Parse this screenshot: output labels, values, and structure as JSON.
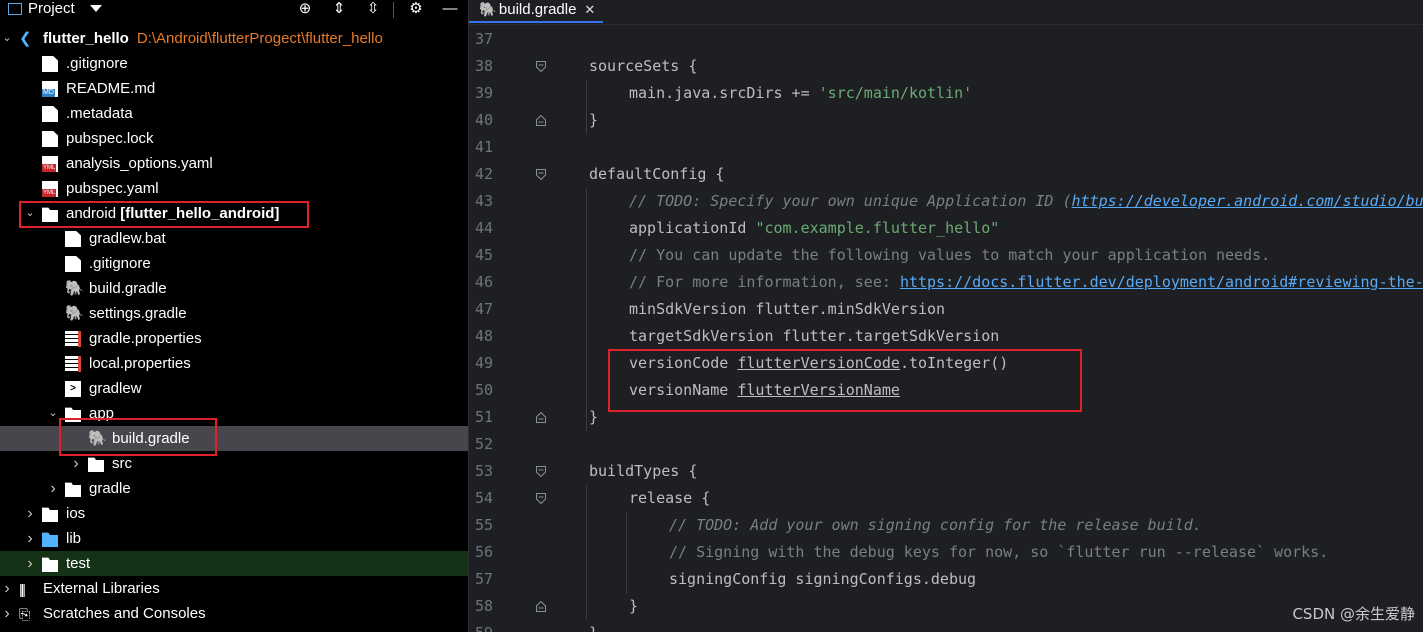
{
  "project_panel": {
    "title": "Project",
    "icons": [
      "project-view-icon",
      "dropdown-caret-icon",
      "locate-icon",
      "expand-all-icon",
      "collapse-all-icon",
      "gear-icon",
      "hide-icon"
    ],
    "tree": [
      {
        "label": "flutter_hello",
        "path": "D:\\Android\\flutterProgect\\flutter_hello",
        "icon": "flutter-icon",
        "depth": 0,
        "expanded": true
      },
      {
        "label": ".gitignore",
        "icon": "gitignore-file-icon",
        "depth": 1
      },
      {
        "label": "README.md",
        "icon": "markdown-file-icon",
        "depth": 1
      },
      {
        "label": ".metadata",
        "icon": "file-icon",
        "depth": 1
      },
      {
        "label": "pubspec.lock",
        "icon": "file-icon",
        "depth": 1
      },
      {
        "label": "analysis_options.yaml",
        "icon": "yaml-file-icon",
        "depth": 1
      },
      {
        "label": "pubspec.yaml",
        "icon": "yaml-file-icon",
        "depth": 1
      },
      {
        "label": "android [flutter_hello_android]",
        "icon": "android-folder-icon",
        "depth": 1,
        "expanded": true
      },
      {
        "label": "gradlew.bat",
        "icon": "file-icon",
        "depth": 2
      },
      {
        "label": ".gitignore",
        "icon": "gitignore-file-icon",
        "depth": 2
      },
      {
        "label": "build.gradle",
        "icon": "gradle-icon",
        "depth": 2
      },
      {
        "label": "settings.gradle",
        "icon": "gradle-icon",
        "depth": 2
      },
      {
        "label": "gradle.properties",
        "icon": "properties-file-icon",
        "depth": 2
      },
      {
        "label": "local.properties",
        "icon": "properties-file-icon",
        "depth": 2
      },
      {
        "label": "gradlew",
        "icon": "terminal-file-icon",
        "depth": 2
      },
      {
        "label": "app",
        "icon": "folder-icon",
        "depth": 2,
        "expanded": true
      },
      {
        "label": "build.gradle",
        "icon": "gradle-icon",
        "depth": 3,
        "selected": true
      },
      {
        "label": "src",
        "icon": "folder-icon",
        "depth": 3,
        "collapsed": true
      },
      {
        "label": "gradle",
        "icon": "folder-icon",
        "depth": 2,
        "collapsed": true
      },
      {
        "label": "ios",
        "icon": "folder-icon",
        "depth": 1,
        "collapsed": true
      },
      {
        "label": "lib",
        "icon": "source-folder-icon",
        "depth": 1,
        "collapsed": true
      },
      {
        "label": "test",
        "icon": "test-folder-icon",
        "depth": 1,
        "collapsed": true
      },
      {
        "label": "External Libraries",
        "icon": "libraries-icon",
        "depth": 0,
        "collapsed": true
      },
      {
        "label": "Scratches and Consoles",
        "icon": "scratches-icon",
        "depth": 0,
        "collapsed": true
      }
    ]
  },
  "editor": {
    "tab": {
      "label": "build.gradle",
      "icon": "gradle-icon",
      "close": "✕"
    },
    "lines": [
      {
        "n": "37",
        "indent": 0,
        "parts": []
      },
      {
        "n": "38",
        "indent": 1,
        "fold": "open",
        "parts": [
          {
            "t": "sourceSets {",
            "c": ""
          }
        ]
      },
      {
        "n": "39",
        "indent": 2,
        "parts": [
          {
            "t": "main.java.srcDirs += ",
            "c": ""
          },
          {
            "t": "'src/main/kotlin'",
            "c": "c-str"
          }
        ]
      },
      {
        "n": "40",
        "indent": 1,
        "fold": "close",
        "parts": [
          {
            "t": "}",
            "c": ""
          }
        ]
      },
      {
        "n": "41",
        "indent": 0,
        "parts": []
      },
      {
        "n": "42",
        "indent": 1,
        "fold": "open",
        "parts": [
          {
            "t": "defaultConfig {",
            "c": ""
          }
        ]
      },
      {
        "n": "43",
        "indent": 2,
        "parts": [
          {
            "t": "// TODO: Specify your own unique Application ID (",
            "c": "c-com"
          },
          {
            "t": "https://developer.android.com/studio/build/application-id.html",
            "c": "c-lnk it"
          },
          {
            "t": ").",
            "c": "c-com"
          }
        ]
      },
      {
        "n": "44",
        "indent": 2,
        "parts": [
          {
            "t": "applicationId ",
            "c": ""
          },
          {
            "t": "\"com.example.flutter_hello\"",
            "c": "c-str"
          }
        ]
      },
      {
        "n": "45",
        "indent": 2,
        "parts": [
          {
            "t": "// You can update the following values to match your application needs.",
            "c": "c-plain-com"
          }
        ]
      },
      {
        "n": "46",
        "indent": 2,
        "parts": [
          {
            "t": "// For more information, see: ",
            "c": "c-plain-com"
          },
          {
            "t": "https://docs.flutter.dev/deployment/android#reviewing-the-build-configuration.",
            "c": "c-lnk"
          }
        ]
      },
      {
        "n": "47",
        "indent": 2,
        "parts": [
          {
            "t": "minSdkVersion flutter.minSdkVersion",
            "c": ""
          }
        ]
      },
      {
        "n": "48",
        "indent": 2,
        "parts": [
          {
            "t": "targetSdkVersion flutter.targetSdkVersion",
            "c": ""
          }
        ]
      },
      {
        "n": "49",
        "indent": 2,
        "parts": [
          {
            "t": "versionCode ",
            "c": ""
          },
          {
            "t": "flutterVersionCode",
            "c": "c-def"
          },
          {
            "t": ".toInteger()",
            "c": ""
          }
        ]
      },
      {
        "n": "50",
        "indent": 2,
        "parts": [
          {
            "t": "versionName ",
            "c": ""
          },
          {
            "t": "flutterVersionName",
            "c": "c-def"
          }
        ]
      },
      {
        "n": "51",
        "indent": 1,
        "fold": "close",
        "parts": [
          {
            "t": "}",
            "c": ""
          }
        ]
      },
      {
        "n": "52",
        "indent": 0,
        "parts": []
      },
      {
        "n": "53",
        "indent": 1,
        "fold": "open",
        "parts": [
          {
            "t": "buildTypes {",
            "c": ""
          }
        ]
      },
      {
        "n": "54",
        "indent": 2,
        "fold": "open",
        "parts": [
          {
            "t": "release {",
            "c": ""
          }
        ]
      },
      {
        "n": "55",
        "indent": 3,
        "parts": [
          {
            "t": "// TODO: Add your own signing config for the release build.",
            "c": "c-com"
          }
        ]
      },
      {
        "n": "56",
        "indent": 3,
        "parts": [
          {
            "t": "// Signing with the debug keys for now, so `flutter run --release` works.",
            "c": "c-plain-com"
          }
        ]
      },
      {
        "n": "57",
        "indent": 3,
        "parts": [
          {
            "t": "signingConfig signingConfigs.debug",
            "c": ""
          }
        ]
      },
      {
        "n": "58",
        "indent": 2,
        "fold": "close",
        "parts": [
          {
            "t": "}",
            "c": ""
          }
        ]
      },
      {
        "n": "59",
        "indent": 1,
        "parts": [
          {
            "t": "}",
            "c": ""
          }
        ]
      }
    ]
  },
  "watermark": "CSDN @余生爱静",
  "colors": {
    "highlight_box": "#e0202a",
    "selection": "#46464c",
    "tab_underline": "#3574f0"
  }
}
